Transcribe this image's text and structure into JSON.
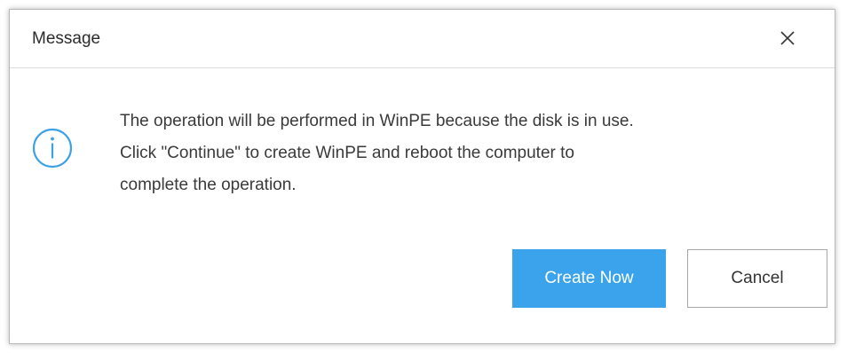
{
  "dialog": {
    "title": "Message",
    "message_lines": [
      "The operation will be performed in WinPE because the disk is in use.",
      "Click \"Continue\" to create WinPE and reboot the computer to",
      "complete the operation."
    ],
    "icon": "info-icon",
    "close_icon": "close-icon",
    "buttons": {
      "primary_label": "Create Now",
      "secondary_label": "Cancel"
    }
  },
  "colors": {
    "accent": "#3ba3ec",
    "icon": "#3aa1e6",
    "text": "#3a3a3a"
  }
}
